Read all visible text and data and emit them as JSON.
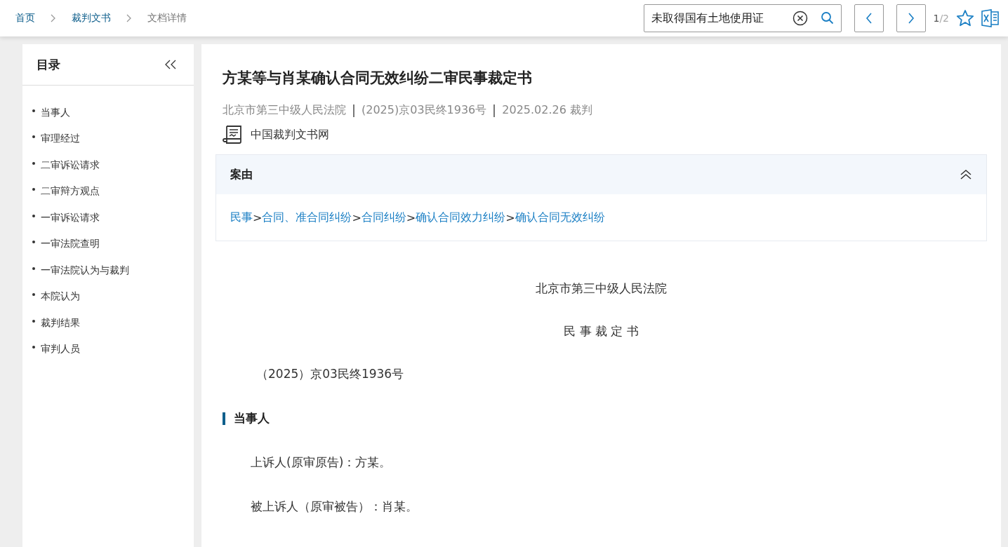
{
  "breadcrumb": [
    {
      "label": "首页",
      "kind": "link"
    },
    {
      "label": "裁判文书",
      "kind": "link"
    },
    {
      "label": "文档详情",
      "kind": "current"
    }
  ],
  "search": {
    "value": "未取得国有土地使用证"
  },
  "pager": {
    "current": "1",
    "total": "/2"
  },
  "toc": {
    "title": "目录",
    "items": [
      {
        "label": "当事人"
      },
      {
        "label": "审理经过"
      },
      {
        "label": "二审诉讼请求"
      },
      {
        "label": "二审辩方观点"
      },
      {
        "label": "一审诉讼请求"
      },
      {
        "label": "一审法院查明"
      },
      {
        "label": "一审法院认为与裁判"
      },
      {
        "label": "本院认为"
      },
      {
        "label": "裁判结果"
      },
      {
        "label": "审判人员"
      }
    ]
  },
  "document": {
    "title": "方某等与肖某确认合同无效纠纷二审民事裁定书",
    "meta": [
      "北京市第三中级人民法院",
      "(2025)京03民终1936号",
      "2025.02.26 裁判"
    ],
    "source": "中国裁判文书网",
    "cause": {
      "title": "案由",
      "expanded": true,
      "path": [
        {
          "text": "民事",
          "kind": "link"
        },
        {
          "text": ">",
          "kind": "sep"
        },
        {
          "text": "合同、准合同纠纷",
          "kind": "link"
        },
        {
          "text": ">",
          "kind": "sep"
        },
        {
          "text": "合同纠纷",
          "kind": "link"
        },
        {
          "text": ">",
          "kind": "sep"
        },
        {
          "text": "确认合同效力纠纷",
          "kind": "link"
        },
        {
          "text": ">",
          "kind": "sep"
        },
        {
          "text": "确认合同无效纠纷",
          "kind": "link"
        }
      ]
    },
    "court": "北京市第三中级人民法院",
    "doc_type": "民 事 裁 定 书",
    "case_number": "（2025）京03民终1936号",
    "sections": [
      {
        "heading": "当事人",
        "paragraphs": [
          "上诉人(原审原告)：方某。",
          "被上诉人（原审被告）：肖某。"
        ]
      }
    ]
  }
}
